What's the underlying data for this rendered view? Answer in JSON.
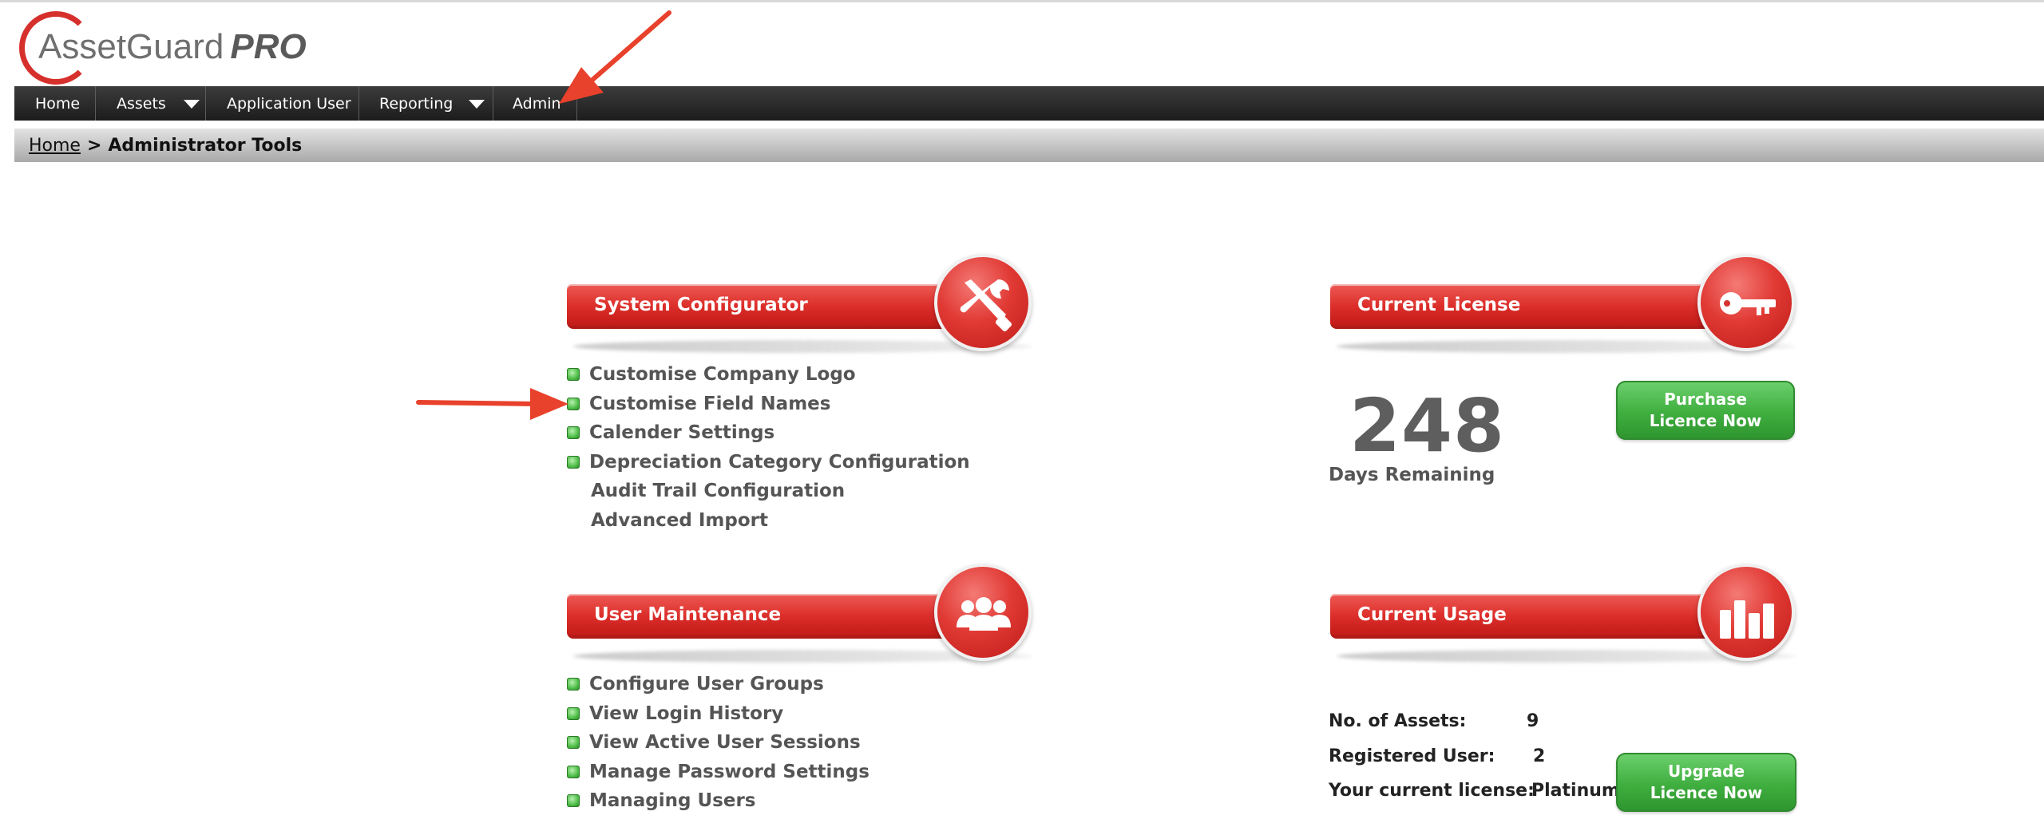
{
  "app": {
    "logo_word": "AssetGuard",
    "logo_pro": "PRO"
  },
  "nav": {
    "items": [
      {
        "label": "Home",
        "has_dropdown": false
      },
      {
        "label": "Assets",
        "has_dropdown": true
      },
      {
        "label": "Application User",
        "has_dropdown": false
      },
      {
        "label": "Reporting",
        "has_dropdown": true
      },
      {
        "label": "Admin",
        "has_dropdown": false
      }
    ]
  },
  "breadcrumb": {
    "home": "Home",
    "separator": ">",
    "current": "Administrator Tools"
  },
  "system_configurator": {
    "title": "System Configurator",
    "icon": "wrench-screwdriver-icon",
    "links": [
      {
        "label": "Customise Company Logo",
        "bullet": true
      },
      {
        "label": "Customise Field Names",
        "bullet": true
      },
      {
        "label": "Calender Settings",
        "bullet": true
      },
      {
        "label": "Depreciation Category Configuration",
        "bullet": true
      },
      {
        "label": "Audit Trail Configuration",
        "bullet": false
      },
      {
        "label": "Advanced Import",
        "bullet": false
      }
    ]
  },
  "user_maintenance": {
    "title": "User Maintenance",
    "icon": "users-group-icon",
    "links": [
      {
        "label": "Configure User Groups",
        "bullet": true
      },
      {
        "label": "View Login History",
        "bullet": true
      },
      {
        "label": "View Active User Sessions",
        "bullet": true
      },
      {
        "label": "Manage Password Settings",
        "bullet": true
      },
      {
        "label": "Managing Users",
        "bullet": true
      }
    ]
  },
  "current_license": {
    "title": "Current License",
    "icon": "key-icon",
    "days_remaining": "248",
    "days_label": "Days Remaining",
    "purchase_button": [
      "Purchase",
      "Licence Now"
    ]
  },
  "current_usage": {
    "title": "Current Usage",
    "icon": "bar-chart-icon",
    "assets_label": "No. of Assets:",
    "assets_value": "9",
    "users_label": "Registered User:",
    "users_value": "2",
    "license_label": "Your current license:",
    "license_value": "Platinum",
    "upgrade_button": [
      "Upgrade",
      "Licence Now"
    ]
  },
  "colors": {
    "section_red": "#db2d29",
    "nav_dark": "#2a2a2a",
    "button_green": "#3fae3f",
    "annotation_arrow": "#e8412c"
  }
}
